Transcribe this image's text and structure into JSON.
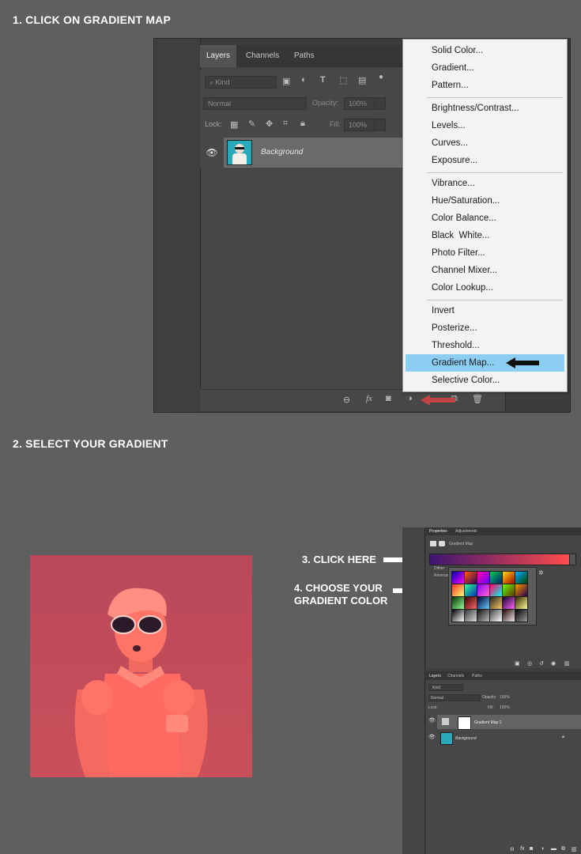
{
  "step1": {
    "title": "1. CLICK ON GRADIENT MAP"
  },
  "step2": {
    "title": "2. SELECT YOUR GRADIENT"
  },
  "layers_panel": {
    "tabs": [
      "Layers",
      "Channels",
      "Paths"
    ],
    "kind_placeholder": "Kind",
    "blend_mode": "Normal",
    "opacity_label": "Opacity:",
    "opacity_value": "100%",
    "lock_label": "Lock:",
    "fill_label": "Fill:",
    "fill_value": "100%",
    "layer_name": "Background"
  },
  "adjustment_menu": {
    "groups": [
      [
        "Solid Color...",
        "Gradient...",
        "Pattern..."
      ],
      [
        "Brightness/Contrast...",
        "Levels...",
        "Curves...",
        "Exposure..."
      ],
      [
        "Vibrance...",
        "Hue/Saturation...",
        "Color Balance...",
        "Black  White...",
        "Photo Filter...",
        "Channel Mixer...",
        "Color Lookup..."
      ],
      [
        "Invert",
        "Posterize...",
        "Threshold...",
        "Gradient Map...",
        "Selective Color..."
      ]
    ],
    "highlighted": "Gradient Map..."
  },
  "callouts": {
    "click_here": "3. CLICK HERE",
    "choose_line1": "4. CHOOSE YOUR",
    "choose_line2": "GRADIENT COLOR"
  },
  "properties_panel": {
    "tabs": [
      "Properties",
      "Adjustments"
    ],
    "header": "Gradient Map",
    "option_dither": "Dither",
    "option_reverse": "Reverse"
  },
  "layers_panel_small": {
    "tabs": [
      "Layers",
      "Channels",
      "Paths"
    ],
    "kind": "Kind",
    "blend_mode": "Normal",
    "opacity_label": "Opacity:",
    "opacity_value": "100%",
    "lock_label": "Lock:",
    "fill_label": "Fill:",
    "fill_value": "100%",
    "layers": [
      "Gradient Map 1",
      "Background"
    ]
  },
  "colors": {
    "menu_highlight": "#8ccdf2",
    "photo_tint": "#c64b57",
    "gradient_start": "#3b1670",
    "gradient_end": "#ff4d4d"
  }
}
